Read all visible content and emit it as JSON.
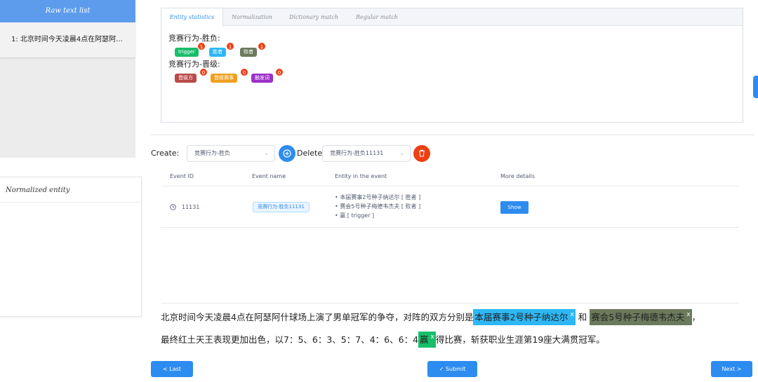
{
  "sidebar": {
    "header": "Raw text list",
    "items": [
      "1: 北京时间今天凌晨4点在阿瑟阿..."
    ]
  },
  "normalized": {
    "title": "Normalized entity"
  },
  "tabs": [
    "Entity statistics",
    "Normalization",
    "Dictionary match",
    "Regular match"
  ],
  "entity_groups": [
    {
      "title": "竞赛行为-胜负:",
      "tags": [
        {
          "label": "trigger",
          "count": "1",
          "color": "#19be6b"
        },
        {
          "label": "胜者",
          "count": "1",
          "color": "#2db7f5"
        },
        {
          "label": "败者",
          "count": "1",
          "color": "#6b7a5c"
        }
      ]
    },
    {
      "title": "竞赛行为-晋级:",
      "tags": [
        {
          "label": "晋级方",
          "count": "0",
          "color": "#b94a48"
        },
        {
          "label": "晋级赛事",
          "count": "0",
          "color": "#f0a020"
        },
        {
          "label": "触发词",
          "count": "0",
          "color": "#9b30c8"
        }
      ]
    }
  ],
  "controls": {
    "create_label": "Create:",
    "create_value": "竞赛行为-胜负",
    "delete_label": "Delete:",
    "delete_value": "竞赛行为-胜负11131"
  },
  "table": {
    "columns": [
      "Event ID",
      "Event name",
      "Entity in the event",
      "More details"
    ],
    "rows": [
      {
        "id": "11131",
        "name": "竞赛行为-胜负11131",
        "entities": [
          "本届赛事2号种子纳达尔 [ 胜者 ]",
          "赛会5号种子梅德韦杰夫 [ 败者 ]",
          "赢 [ trigger ]"
        ],
        "action": "Show"
      }
    ]
  },
  "text": {
    "p1": "北京时间今天凌晨4点在阿瑟阿什球场上演了男单冠军的争夺，对阵的双方分别是",
    "h1": "本届赛事2号种子纳达尔",
    "p2": "和",
    "h2": "赛会5号种子梅德韦杰夫",
    "p3": "，",
    "p4": "最终红土天王表现更加出色，以7：5、6：3、5：7、4：6、6：4",
    "h3": "赢",
    "p5": "得比赛，斩获职业生涯第19座大满贯冠军。",
    "close": "x"
  },
  "buttons": {
    "last": "< Last",
    "submit": "✓ Submit",
    "next": "Next >"
  }
}
